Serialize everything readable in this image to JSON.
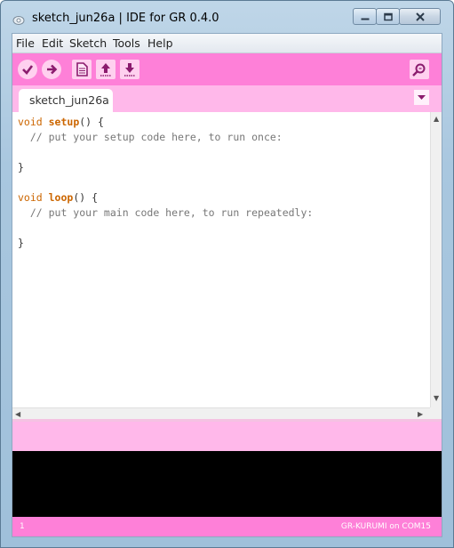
{
  "window": {
    "title": "sketch_jun26a | IDE for GR 0.4.0"
  },
  "menu": {
    "items": [
      "File",
      "Edit",
      "Sketch",
      "Tools",
      "Help"
    ]
  },
  "toolbar": {
    "buttons": [
      "verify-icon",
      "upload-arrow-icon",
      "new-document-icon",
      "open-up-arrow-icon",
      "save-down-arrow-icon",
      "serial-monitor-icon"
    ],
    "accent": "#fe80d8"
  },
  "tabs": {
    "active": "sketch_jun26a"
  },
  "editor": {
    "lines": [
      {
        "k": "void ",
        "f": "setup",
        "r": "() {"
      },
      {
        "c": "  // put your setup code here, to run once:"
      },
      {
        "t": ""
      },
      {
        "t": "}"
      },
      {
        "t": ""
      },
      {
        "k": "void ",
        "f": "loop",
        "r": "() {"
      },
      {
        "c": "  // put your main code here, to run repeatedly:"
      },
      {
        "t": ""
      },
      {
        "t": "}"
      }
    ]
  },
  "status": {
    "line": "1",
    "board": "GR-KURUMI on COM15"
  }
}
